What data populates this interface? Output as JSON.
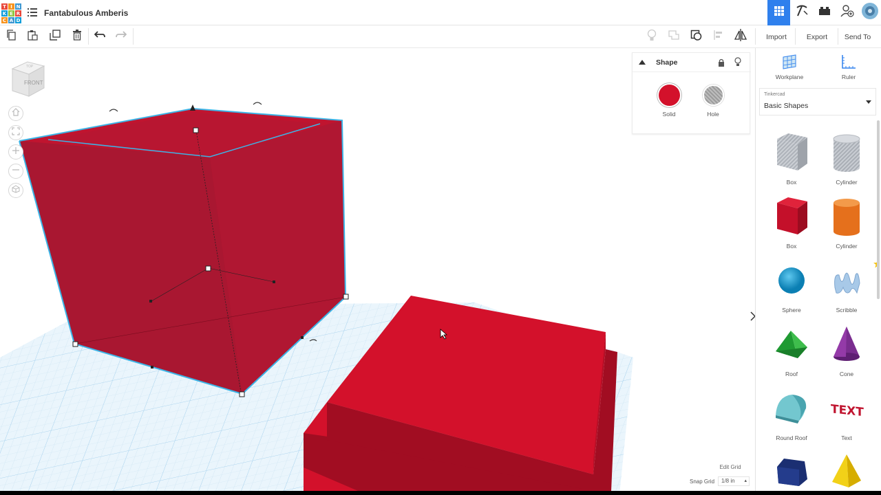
{
  "app": {
    "title": "Fantabulous Amberis",
    "logo_letters": [
      "T",
      "I",
      "N",
      "K",
      "E",
      "R",
      "C",
      "A",
      "D"
    ],
    "logo_colors": [
      "#e8473a",
      "#f7931e",
      "#3e97d1",
      "#0e9dd9",
      "#8dc63f",
      "#e8473a",
      "#f7931e",
      "#3e97d1",
      "#0e9dd9"
    ]
  },
  "toolbar": {
    "import_label": "Import",
    "export_label": "Export",
    "send_to_label": "Send To"
  },
  "viewcube": {
    "front_label": "FRONT",
    "top_label": "TOP"
  },
  "inspector": {
    "title": "Shape",
    "solid_label": "Solid",
    "hole_label": "Hole",
    "solid_color": "#d3112b"
  },
  "panel": {
    "workplane_label": "Workplane",
    "ruler_label": "Ruler",
    "library_source": "Tinkercad",
    "library_name": "Basic Shapes",
    "shapes": [
      {
        "name": "Box"
      },
      {
        "name": "Cylinder"
      },
      {
        "name": "Box"
      },
      {
        "name": "Cylinder"
      },
      {
        "name": "Sphere"
      },
      {
        "name": "Scribble"
      },
      {
        "name": "Roof"
      },
      {
        "name": "Cone"
      },
      {
        "name": "Round Roof"
      },
      {
        "name": "Text"
      },
      {
        "name": ""
      },
      {
        "name": ""
      }
    ],
    "text_shape_glyph": "TEXT"
  },
  "bottom": {
    "edit_grid_label": "Edit Grid",
    "snap_grid_label": "Snap Grid",
    "snap_grid_value": "1/8 in"
  },
  "colors": {
    "accent": "#2f80ed",
    "shape_red": "#d3112b",
    "shape_red_dark": "#a10d22",
    "selection_outline": "#3cb4e6",
    "grid_line": "#cfe6f4"
  }
}
